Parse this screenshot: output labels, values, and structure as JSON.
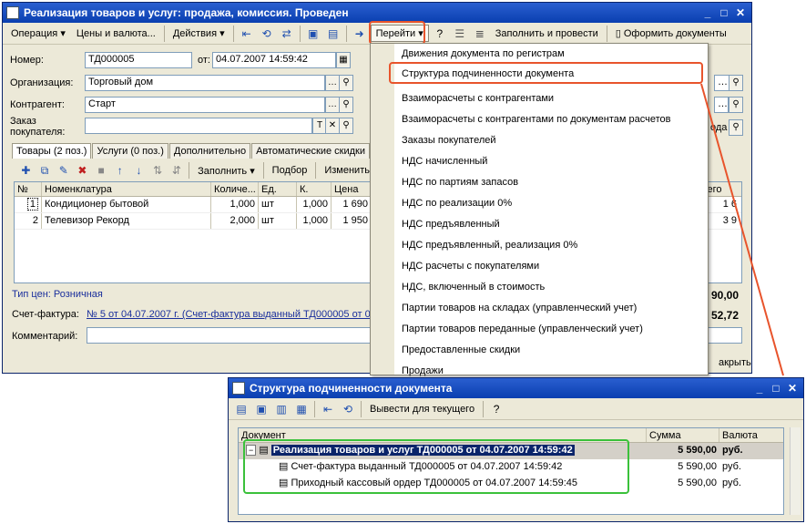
{
  "main_window": {
    "title": "Реализация товаров и услуг: продажа, комиссия. Проведен",
    "toolbar": {
      "operation": "Операция",
      "prices": "Цены и валюта...",
      "actions": "Действия",
      "goto": "Перейти",
      "fill_post": "Заполнить и провести",
      "print_docs": "Оформить документы"
    },
    "form": {
      "number_label": "Номер:",
      "number_value": "ТД000005",
      "from_label": "от:",
      "date_value": "04.07.2007 14:59:42",
      "org_label": "Организация:",
      "org_value": "Торговый дом",
      "contractor_label": "Контрагент:",
      "contractor_value": "Старт",
      "order_label": "Заказ покупателя:",
      "order_value": ""
    },
    "tabs": [
      "Товары (2 поз.)",
      "Услуги (0 поз.)",
      "Дополнительно",
      "Автоматические скидки"
    ],
    "grid_toolbar": {
      "fill": "Заполнить",
      "selection": "Подбор",
      "change": "Изменить"
    },
    "grid": {
      "columns": [
        "№",
        "Номенклатура",
        "Количе...",
        "Ед.",
        "К.",
        "Цена"
      ],
      "rows": [
        [
          "1",
          "Кондиционер бытовой",
          "1,000",
          "шт",
          "1,000",
          "1 690"
        ],
        [
          "2",
          "Телевизор Рекорд",
          "2,000",
          "шт",
          "1,000",
          "1 950"
        ]
      ],
      "right_col_header": "сего",
      "right_values": [
        "1 6",
        "3 9"
      ]
    },
    "right_labels": {
      "oda": "ода"
    },
    "price_type": "Тип цен: Розничная",
    "invoice_label": "Счет-фактура:",
    "invoice_value": "№ 5 от 04.07.2007 г. (Счет-фактура выданный ТД000005 от 04",
    "comment_label": "Комментарий:",
    "total1": "90,00",
    "total2": "52,72",
    "close_label": "акрыть"
  },
  "goto_menu": {
    "items": [
      "Движения документа по регистрам",
      "Структура подчиненности документа",
      "Взаиморасчеты с контрагентами",
      "Взаиморасчеты с контрагентами по документам расчетов",
      "Заказы покупателей",
      "НДС начисленный",
      "НДС по партиям запасов",
      "НДС по реализации 0%",
      "НДС предъявленный",
      "НДС предъявленный, реализация 0%",
      "НДС расчеты с покупателями",
      "НДС, включенный в стоимость",
      "Партии товаров на складах (управленческий учет)",
      "Партии товаров переданные (управленческий учет)",
      "Предоставленные скидки",
      "Продажи"
    ]
  },
  "structure_window": {
    "title": "Структура подчиненности документа",
    "toolbar_label": "Вывести для текущего",
    "columns": [
      "Документ",
      "Сумма",
      "Валюта"
    ],
    "rows": [
      {
        "name": "Реализация товаров и услуг ТД000005 от 04.07.2007 14:59:42",
        "sum": "5 590,00",
        "cur": "руб."
      },
      {
        "name": "Счет-фактура выданный ТД000005 от 04.07.2007 14:59:42",
        "sum": "5 590,00",
        "cur": "руб."
      },
      {
        "name": "Приходный кассовый ордер ТД000005 от 04.07.2007 14:59:45",
        "sum": "5 590,00",
        "cur": "руб."
      }
    ]
  },
  "colors": {
    "title_bar": "#0a3fb0",
    "highlight_red": "#e8542c",
    "highlight_green": "#3bc13b",
    "selection": "#0a246a"
  }
}
